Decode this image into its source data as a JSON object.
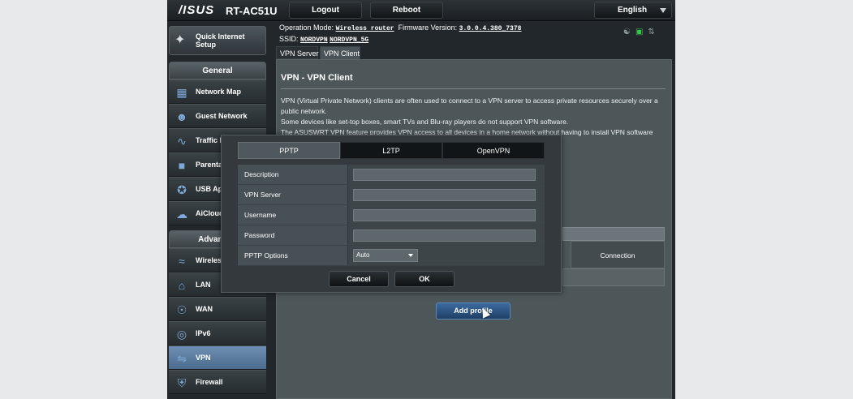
{
  "header": {
    "brand": "/ISUS",
    "model": "RT-AC51U",
    "logout_label": "Logout",
    "reboot_label": "Reboot",
    "language": "English"
  },
  "status": {
    "mode_label": "Operation Mode:",
    "mode_value": "Wireless router",
    "firmware_label": "Firmware Version:",
    "firmware_value": "3.0.0.4.380_7378",
    "ssid_label": "SSID:",
    "ssid_1": "NORDVPN",
    "ssid_2": "NORDVPN_5G"
  },
  "sidebar": {
    "qis_label_1": "Quick Internet",
    "qis_label_2": "Setup",
    "general_title": "General",
    "general_items": [
      {
        "label": "Network Map",
        "icon": "network-map-icon"
      },
      {
        "label": "Guest Network",
        "icon": "guest-network-icon"
      },
      {
        "label": "Traffic I",
        "icon": "traffic-icon"
      },
      {
        "label": "Parenta",
        "icon": "parental-icon"
      },
      {
        "label": "USB Ap",
        "icon": "usb-icon"
      },
      {
        "label": "AiCloud",
        "icon": "cloud-icon"
      }
    ],
    "advanced_title": "Advanced",
    "advanced_items": [
      {
        "label": "Wireles",
        "icon": "wireless-icon"
      },
      {
        "label": "LAN",
        "icon": "lan-icon"
      },
      {
        "label": "WAN",
        "icon": "wan-icon"
      },
      {
        "label": "IPv6",
        "icon": "ipv6-icon"
      },
      {
        "label": "VPN",
        "icon": "vpn-icon"
      },
      {
        "label": "Firewall",
        "icon": "firewall-icon"
      }
    ]
  },
  "tabs": {
    "server": "VPN Server",
    "client": "VPN Client"
  },
  "content": {
    "title": "VPN - VPN Client",
    "desc_1": "VPN (Virtual Private Network) clients are often used to connect to a VPN server to access private resources securely over a",
    "desc_2": "public network.",
    "desc_3": "Some devices like set-top boxes, smart TVs and Blu-ray players do not support VPN software.",
    "desc_4": "The ASUSWRT VPN feature provides VPN access to all devices in a home network without having to install VPN software on",
    "connection_header": "Connection",
    "add_profile": "Add profile"
  },
  "modal": {
    "tabs": [
      "PPTP",
      "L2TP",
      "OpenVPN"
    ],
    "fields": {
      "description_label": "Description",
      "vpn_server_label": "VPN Server",
      "username_label": "Username",
      "password_label": "Password",
      "pptp_options_label": "PPTP Options",
      "pptp_options_value": "Auto"
    },
    "cancel_label": "Cancel",
    "ok_label": "OK"
  }
}
